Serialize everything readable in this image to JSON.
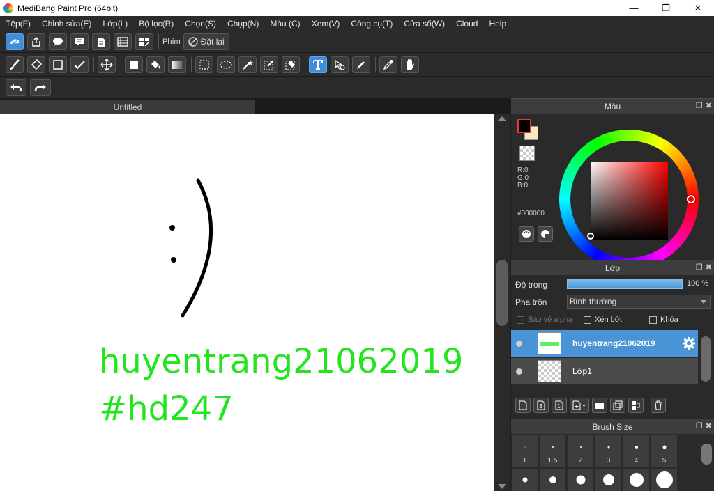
{
  "window": {
    "title": "MediBang Paint Pro (64bit)",
    "controls": {
      "minimize": "—",
      "maximize": "❐",
      "close": "✕"
    }
  },
  "menu": [
    "Tệp(F)",
    "Chỉnh sửa(E)",
    "Lớp(L)",
    "Bộ lọc(R)",
    "Chọn(S)",
    "Chụp(N)",
    "Màu (C)",
    "Xem(V)",
    "Công cụ(T)",
    "Cửa sổ(W)",
    "Cloud",
    "Help"
  ],
  "toolbar1": {
    "icons": [
      "cloud-save-icon",
      "upload-icon",
      "comment-icon",
      "chat-icon",
      "document-icon",
      "list-icon",
      "grid-icon"
    ],
    "shortcut_label": "Phím",
    "reset_label": "Đặt lại"
  },
  "toolbar2": {
    "tools": [
      "brush-tool",
      "eraser-tool",
      "rectangle-tool",
      "dot-line-tool",
      "move-tool",
      "fill-shape-tool",
      "bucket-tool",
      "gradient-tool",
      "select-rect-tool",
      "lasso-tool",
      "magic-wand-tool",
      "select-pen-tool",
      "select-eraser-tool",
      "text-tool",
      "operation-tool",
      "dropper-tool",
      "eyedropper-tool",
      "hand-tool"
    ],
    "active_tool": "text-tool"
  },
  "toolbar3": {
    "tools": [
      "undo",
      "redo"
    ]
  },
  "document": {
    "tab_title": "Untitled",
    "canvas_text_line1": "huyentrang21062019",
    "canvas_text_line2": "#hd247",
    "text_color": "#22e51e"
  },
  "color_panel": {
    "title": "Màu",
    "r_label": "R:0",
    "g_label": "G:0",
    "b_label": "B:0",
    "hex": "#000000",
    "foreground": "#000000",
    "background": "#fbe7c0"
  },
  "layer_panel": {
    "title": "Lớp",
    "opacity_label": "Độ trong",
    "opacity_value": "100 %",
    "opacity_percent": 100,
    "blend_label": "Pha trộn",
    "blend_mode": "Bình thường",
    "protect_alpha": "Bảo vệ alpha",
    "clipping": "Xén bớt",
    "lock": "Khóa",
    "layers": [
      {
        "name": "huyentrang21062019",
        "selected": true
      },
      {
        "name": "Lớp1",
        "selected": false
      }
    ]
  },
  "brush_panel": {
    "title": "Brush Size",
    "sizes": [
      "1",
      "1.5",
      "2",
      "3",
      "4",
      "5"
    ]
  }
}
